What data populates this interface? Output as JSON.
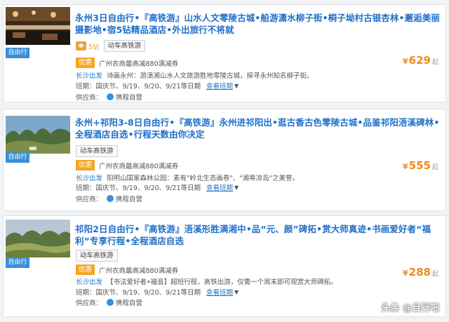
{
  "listings": [
    {
      "title": "永州3日自由行•『高铁游』山水人文零陵古城•船游潇水柳子街•桐子坳村古银杏林•邂逅美丽摄影地•宿5钻精品酒店•外出旅行不将就",
      "tag": "自由行",
      "rank": "5钻",
      "transport": "动车高铁游",
      "promo_tag": "优惠",
      "promo_text": "广州农商最高减880满减券",
      "departure": "长沙出发",
      "features": "诗画永州：游潇湘山水人文旅游胜地零陵古城，探寻永州知名柳子街。",
      "schedule_label": "班期：",
      "schedule": "国庆节、9/19、9/20、9/21等日期",
      "schedule_link": "查看班期",
      "supplier_label": "供应商：",
      "supplier": "携程自营",
      "currency": "¥",
      "price": "629",
      "price_suffix": "起"
    },
    {
      "title": "永州+祁阳3-8日自由行•『高铁游』永州进祁阳出•逛古香古色零陵古城•品鉴祁阳浯溪碑林•全程酒店自选•行程天数由你决定",
      "tag": "自由行",
      "transport": "动车高铁游",
      "promo_tag": "优惠",
      "promo_text": "广州农商最高减880满减券",
      "departure": "长沙出发",
      "features": "阳明山国家森林公园：素有\"岭北生态画卷\"、\"湘粤凉岛\"之美誉。",
      "schedule_label": "班期：",
      "schedule": "国庆节、9/19、9/20、9/21等日期",
      "schedule_link": "查看班期",
      "supplier_label": "供应商：",
      "supplier": "携程自营",
      "currency": "¥",
      "price": "555",
      "price_suffix": "起"
    },
    {
      "title": "祁阳2日自由行•『高铁游』浯溪形胜满湘中•品“元、颜”碑拓•赏大师真迹•书画爱好者“福利”专享行程•全程酒店自选",
      "tag": "自由行",
      "transport": "动车高铁游",
      "promo_tag": "优惠",
      "promo_text": "广州农商最高减880满减券",
      "departure": "长沙出发",
      "features": "【书法爱好者•福音】超短行程，高铁出游，仅需一个周末即可观赏大师碑拓。",
      "schedule_label": "班期：",
      "schedule": "国庆节、9/19、9/20、9/21等日期",
      "schedule_link": "查看班期",
      "supplier_label": "供应商：",
      "supplier": "携程自营",
      "currency": "¥",
      "price": "288",
      "price_suffix": "起"
    }
  ],
  "watermark": "头条 @且行吧",
  "colors": {
    "title": "#1f6fc8",
    "price": "#f08a1c",
    "tag": "#3a8fd8",
    "promo": "#f5a623"
  }
}
